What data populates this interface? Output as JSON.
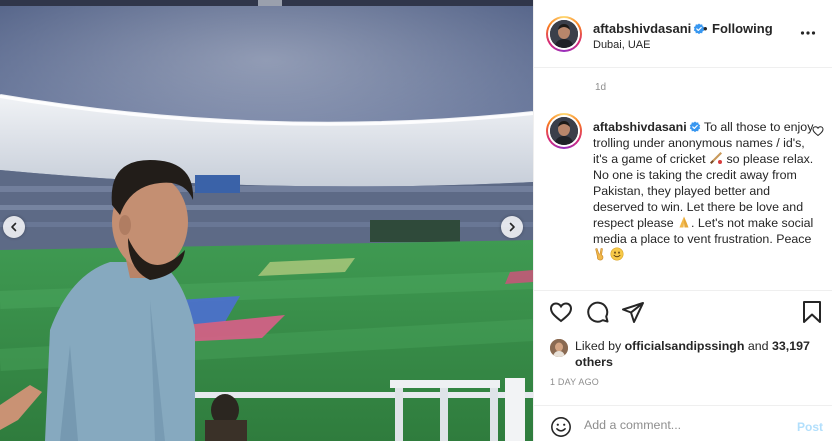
{
  "post": {
    "author": "aftabshivdasani",
    "follow_status": "Following",
    "separator": "•",
    "location": "Dubai, UAE",
    "relative_time": "1d",
    "caption": {
      "author": "aftabshivdasani",
      "segments": [
        "To all those to enjoy trolling under anonymous names / id's, it's a game of cricket ",
        " so please relax. No one is taking the credit away from Pakistan, they played better and deserved to win. Let there be love and respect please ",
        ". Let's not make social media a place to vent frustration. Peace ",
        " "
      ],
      "emoji_icons": [
        "cricket-bat-emoji",
        "folded-hands-emoji",
        "victory-hand-emoji",
        "smiling-face-emoji"
      ]
    },
    "likes": {
      "prefix": "Liked by",
      "user": "officialsandipssingh",
      "joiner": "and",
      "others": "33,197 others"
    },
    "timestamp": "1 DAY AGO"
  },
  "comment": {
    "placeholder": "Add a comment...",
    "post_label": "Post"
  },
  "icons": {
    "verified": "verified-badge-icon",
    "more": "more-options-icon",
    "like": "heart-icon",
    "comment": "comment-icon",
    "share": "share-icon",
    "save": "bookmark-icon",
    "emoji": "smiley-icon",
    "prev": "chevron-left-icon",
    "next": "chevron-right-icon"
  },
  "colors": {
    "verified": "#3897f0",
    "post_disabled": "#b2dffc",
    "muted": "#8e8e8e",
    "text": "#262626",
    "border": "#efefef"
  }
}
